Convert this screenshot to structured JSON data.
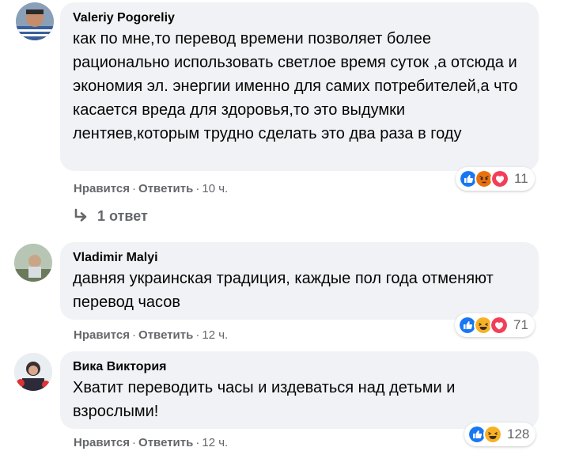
{
  "comments": [
    {
      "author": "Valeriy Pogoreliy",
      "text": "как по мне,то перевод времени позволяет более рационально использовать светлое время суток ,а отсюда и экономия эл. энергии именно для самих потребителей,а что касается вреда для здоровья,то это выдумки лентяев,которым трудно сделать это два раза в году",
      "like_label": "Нравится",
      "reply_label": "Ответить",
      "time": "10 ч.",
      "reaction_count": "11",
      "reaction_icons": [
        "like-reaction-icon",
        "angry-reaction-icon",
        "love-reaction-icon"
      ],
      "replies_label": "1 ответ"
    },
    {
      "author": "Vladimir Malyi",
      "text": "давняя украинская традиция, каждые пол года отменяют перевод часов",
      "like_label": "Нравится",
      "reply_label": "Ответить",
      "time": "12 ч.",
      "reaction_count": "71",
      "reaction_icons": [
        "like-reaction-icon",
        "haha-reaction-icon",
        "love-reaction-icon"
      ]
    },
    {
      "author": "Вика Виктория",
      "text": "Хватит переводить часы и издеваться над детьми и взрослыми!",
      "like_label": "Нравится",
      "reply_label": "Ответить",
      "time": "12 ч.",
      "reaction_count": "128",
      "reaction_icons": [
        "like-reaction-icon",
        "haha-reaction-icon"
      ]
    }
  ],
  "colors": {
    "bubble": "#f0f2f5",
    "secondary_text": "#65676b",
    "like_blue": "#1877f2",
    "love_red": "#f33e58",
    "angry_orange": "#e9710f",
    "haha_yellow": "#f7b125"
  }
}
